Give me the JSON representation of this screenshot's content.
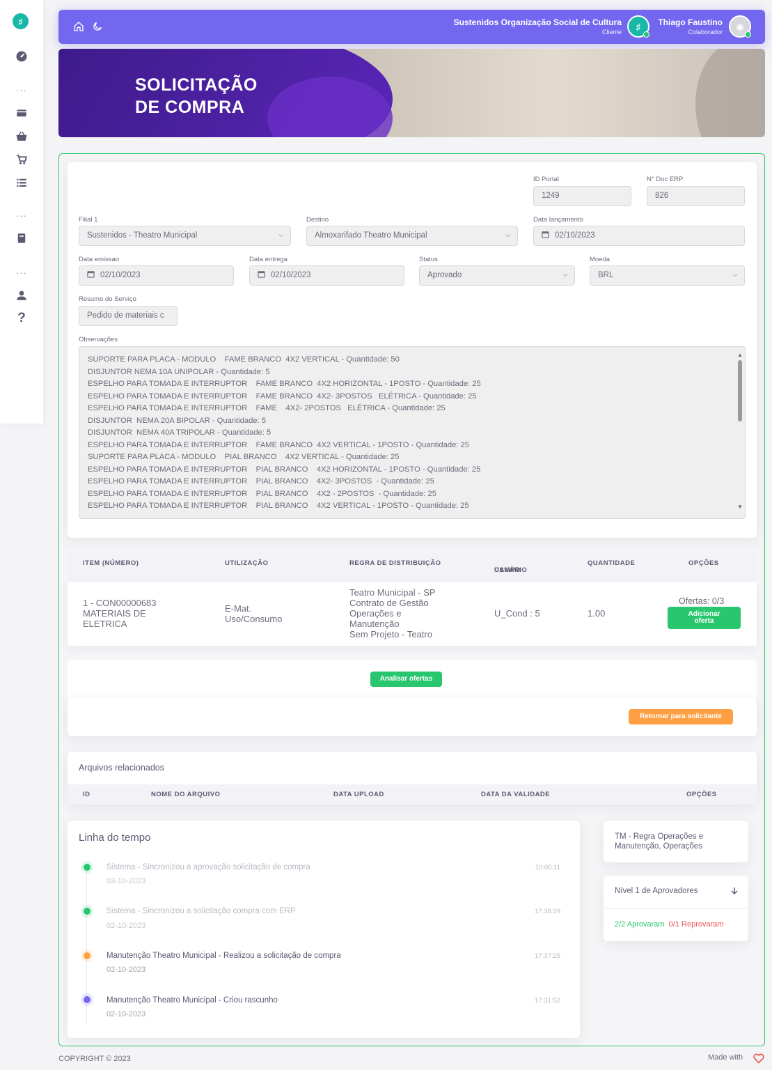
{
  "header": {
    "org_name": "Sustenidos Organização Social de Cultura",
    "org_role": "Cliente",
    "user_name": "Thiago Faustino",
    "user_role": "Colaborador"
  },
  "banner": {
    "title_line1": "SOLICITAÇÃO",
    "title_line2": "DE COMPRA"
  },
  "form": {
    "id_portal_label": "ID Portal",
    "id_portal": "1249",
    "doc_erp_label": "N° Doc ERP",
    "doc_erp": "826",
    "filial_label": "Filial 1",
    "filial": "Sustenidos - Theatro Municipal",
    "destino_label": "Destino",
    "destino": "Almoxarifado Theatro Municipal",
    "data_lancamento_label": "Data lançamento",
    "data_lancamento": "02/10/2023",
    "data_emissao_label": "Data emissao",
    "data_emissao": "02/10/2023",
    "data_entrega_label": "Data entrega",
    "data_entrega": "02/10/2023",
    "status_label": "Status",
    "status": "Aprovado",
    "moeda_label": "Moeda",
    "moeda": "BRL",
    "resumo_label": "Resumo do Serviço",
    "resumo": "Pedido de materiais c",
    "obs_label": "Observações",
    "obs_lines": [
      "SUPORTE PARA PLACA - MODULO    FAME BRANCO  4X2 VERTICAL - Quantidade: 50",
      "DISJUNTOR NEMA 10A UNIPOLAR - Quantidade: 5",
      "ESPELHO PARA TOMADA E INTERRUPTOR    FAME BRANCO  4X2 HORIZONTAL - 1POSTO - Quantidade: 25",
      "ESPELHO PARA TOMADA E INTERRUPTOR    FAME BRANCO  4X2- 3POSTOS   ELÉTRICA - Quantidade: 25",
      "ESPELHO PARA TOMADA E INTERRUPTOR    FAME    4X2- 2POSTOS   ELÉTRICA - Quantidade: 25",
      "DISJUNTOR  NEMA 20A BIPOLAR - Quantidade: 5",
      "DISJUNTOR  NEMA 40A TRIPOLAR - Quantidade: 5",
      "ESPELHO PARA TOMADA E INTERRUPTOR    FAME BRANCO  4X2 VERTICAL - 1POSTO - Quantidade: 25",
      "SUPORTE PARA PLACA - MODULO    PIAL BRANCO    4X2 VERTICAL - Quantidade: 25",
      "ESPELHO PARA TOMADA E INTERRUPTOR    PIAL BRANCO    4X2 HORIZONTAL - 1POSTO - Quantidade: 25",
      "ESPELHO PARA TOMADA E INTERRUPTOR    PIAL BRANCO    4X2- 3POSTOS  - Quantidade: 25",
      "ESPELHO PARA TOMADA E INTERRUPTOR    PIAL BRANCO    4X2 - 2POSTOS  - Quantidade: 25",
      "ESPELHO PARA TOMADA E INTERRUPTOR    PIAL BRANCO    4X2 VERTICAL - 1POSTO - Quantidade: 25"
    ]
  },
  "items_table": {
    "headers": [
      "ITEM (NÚMERO)",
      "UTILIZAÇÃO",
      "REGRA DE DISTRIBUIÇÃO",
      "CAMPO",
      "USUÁRIO",
      "QUANTIDADE",
      "OPÇÕES"
    ],
    "row": {
      "item_l1": "1 - CON00000683",
      "item_l2": "MATERIAIS DE",
      "item_l3": "ELETRICA",
      "util_l1": "E-Mat.",
      "util_l2": "Uso/Consumo",
      "regra": [
        "Teatro Municipal - SP",
        "Contrato de Gestão",
        "Operações e",
        "Manutenção",
        "Sem Projeto - Teatro"
      ],
      "campo": "U_Cond : 5",
      "quantidade": "1.00",
      "ofertas": "Ofertas: 0/3",
      "add_l1": "Adicionar",
      "add_l2": "oferta"
    }
  },
  "actions": {
    "analisar": "Analisar ofertas",
    "retornar": "Retornar para solicitante"
  },
  "files": {
    "title": "Arquivos relacionados",
    "headers": [
      "ID",
      "NOME DO ARQUIVO",
      "DATA UPLOAD",
      "DATA DA VALIDADE",
      "OPÇÕES"
    ]
  },
  "timeline": {
    "title": "Linha do tempo",
    "items": [
      {
        "title": "Sistema - Sincronizou a aprovação solicitação de compra",
        "date": "03-10-2023",
        "time": "10:05:11",
        "color": "#28c76f"
      },
      {
        "title": "Sistema - Sincronizou a solicitação compra com ERP",
        "date": "02-10-2023",
        "time": "17:38:19",
        "color": "#28c76f"
      },
      {
        "title": "Manutenção Theatro Municipal - Realizou a solicitação de compra",
        "date": "02-10-2023",
        "time": "17:37:25",
        "color": "#ff9f43"
      },
      {
        "title": "Manutenção Theatro Municipal - Criou rascunho",
        "date": "02-10-2023",
        "time": "17:31:52",
        "color": "#7367f0"
      }
    ]
  },
  "rule_panel": {
    "rule_l1": "TM - Regra Operações e",
    "rule_l2": "Manutenção, Operações",
    "level": "Nível 1 de Aprovadores",
    "approved": "2/2 Aprovaram",
    "rejected": "0/1 Reprovaram"
  },
  "footer": {
    "copyright": "COPYRIGHT © 2023",
    "made_with": "Made with"
  },
  "colors": {
    "primary": "#7367f0",
    "success": "#28c76f",
    "warning": "#ff9f43",
    "danger": "#ea5455"
  }
}
